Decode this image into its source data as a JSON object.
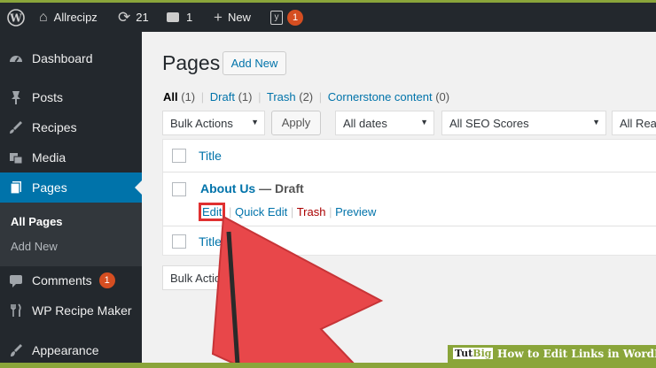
{
  "topbar": {
    "site_name": "Allrecipz",
    "updates_count": "21",
    "comments_count": "1",
    "new_label": "New",
    "yoast_badge": "1"
  },
  "sidebar": {
    "items": [
      {
        "label": "Dashboard"
      },
      {
        "label": "Posts"
      },
      {
        "label": "Recipes"
      },
      {
        "label": "Media"
      },
      {
        "label": "Pages"
      },
      {
        "label": "Comments",
        "badge": "1"
      },
      {
        "label": "WP Recipe Maker"
      },
      {
        "label": "Appearance"
      }
    ],
    "submenu": [
      {
        "label": "All Pages"
      },
      {
        "label": "Add New"
      }
    ]
  },
  "main": {
    "title": "Pages",
    "add_new_label": "Add New",
    "filters": {
      "all": "All",
      "all_count": "(1)",
      "draft": "Draft",
      "draft_count": "(1)",
      "trash": "Trash",
      "trash_count": "(2)",
      "cornerstone": "Cornerstone content",
      "cornerstone_count": "(0)",
      "sep": "|"
    },
    "bulk_actions": "Bulk Actions",
    "apply_label": "Apply",
    "dates_select": "All dates",
    "seo_select": "All SEO Scores",
    "readability_select": "All Rea",
    "table": {
      "title_header": "Title",
      "row_title": "About Us",
      "row_state": " — Draft",
      "actions": {
        "edit": "Edit",
        "quick_edit": "Quick Edit",
        "trash": "Trash",
        "preview": "Preview"
      },
      "footer_title": "Title"
    },
    "bottom_bulk_actions": "Bulk Actions"
  },
  "watermark": {
    "brand_a": "Tut",
    "brand_b": "Big",
    "caption": "How to Edit Links in WordPress"
  },
  "colors": {
    "admin_bar": "#23282d",
    "accent": "#0073aa",
    "arrow": "#e8474a",
    "highlight_box": "#e03030",
    "frame_green": "#8aa53a"
  }
}
